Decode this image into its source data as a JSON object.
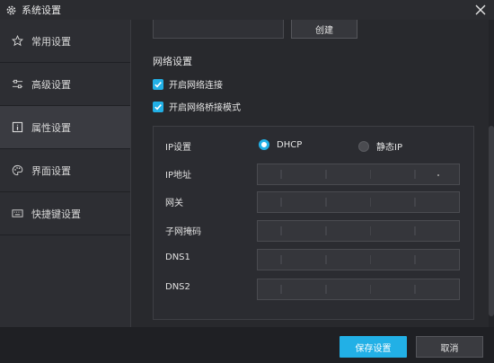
{
  "window": {
    "title": "系统设置"
  },
  "sidebar": {
    "items": [
      {
        "label": "常用设置",
        "icon": "star-icon"
      },
      {
        "label": "高级设置",
        "icon": "sliders-icon"
      },
      {
        "label": "属性设置",
        "icon": "info-icon",
        "active": true
      },
      {
        "label": "界面设置",
        "icon": "palette-icon"
      },
      {
        "label": "快捷键设置",
        "icon": "keyboard-icon"
      }
    ]
  },
  "top": {
    "create_label": "创建"
  },
  "network": {
    "section_title": "网络设置",
    "enable_network_label": "开启网络连接",
    "enable_bridge_label": "开启网络桥接模式",
    "ip_setting_label": "IP设置",
    "dhcp_label": "DHCP",
    "static_ip_label": "静态IP",
    "mode": "DHCP",
    "ip_address_label": "IP地址",
    "gateway_label": "网关",
    "subnet_mask_label": "子网掩码",
    "dns1_label": "DNS1",
    "dns2_label": "DNS2"
  },
  "footer": {
    "save_label": "保存设置",
    "cancel_label": "取消"
  },
  "colors": {
    "accent": "#22b0e6",
    "background": "#28292d"
  }
}
